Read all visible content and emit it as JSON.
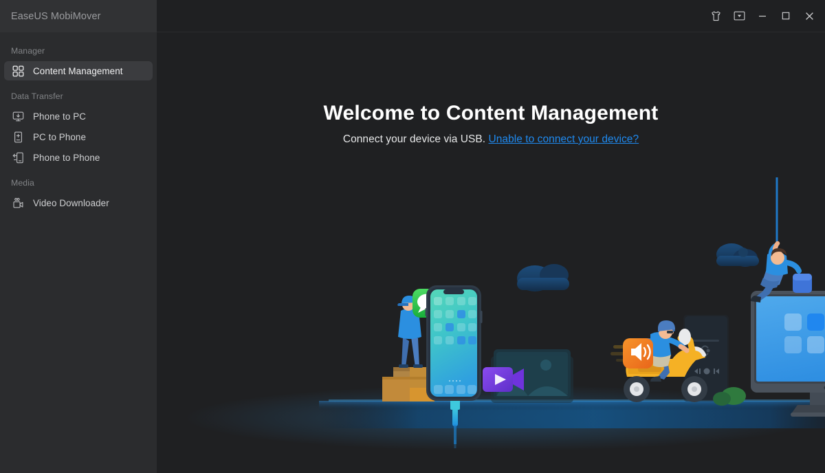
{
  "window": {
    "app_title": "EaseUS MobiMover",
    "controls": [
      {
        "name": "theme-shirt-icon",
        "label": "Theme"
      },
      {
        "name": "menu-dropdown-icon",
        "label": "Menu"
      },
      {
        "name": "minimize-icon",
        "label": "Minimize"
      },
      {
        "name": "maximize-icon",
        "label": "Maximize"
      },
      {
        "name": "close-icon",
        "label": "Close"
      }
    ]
  },
  "sidebar": {
    "groups": [
      {
        "label": "Manager",
        "items": [
          {
            "label": "Content Management",
            "icon": "grid-icon",
            "active": true
          }
        ]
      },
      {
        "label": "Data Transfer",
        "items": [
          {
            "label": "Phone to PC",
            "icon": "monitor-download-icon",
            "active": false
          },
          {
            "label": "PC to Phone",
            "icon": "phone-plus-icon",
            "active": false
          },
          {
            "label": "Phone to Phone",
            "icon": "phone-transfer-icon",
            "active": false
          }
        ]
      },
      {
        "label": "Media",
        "items": [
          {
            "label": "Video Downloader",
            "icon": "video-camera-icon",
            "active": false
          }
        ]
      }
    ]
  },
  "main": {
    "welcome_title": "Welcome to Content Management",
    "welcome_text": "Connect your device via USB.",
    "welcome_link": "Unable to connect your device?"
  },
  "colors": {
    "sidebar_bg": "#2b2c2e",
    "sidebar_header_bg": "#313234",
    "main_bg": "#1f2022",
    "active_item_bg": "#3b3c3f",
    "link_blue": "#1f8af0",
    "accent_cyan": "#29c2d8",
    "scooter_yellow": "#f5b125",
    "speaker_orange": "#f07c1b",
    "video_purple": "#7b3fe4",
    "message_green": "#2fc44c",
    "shirt_blue": "#2b8fe0",
    "monitor_blue": "#3d9ee8",
    "box_brown": "#c0852f"
  }
}
